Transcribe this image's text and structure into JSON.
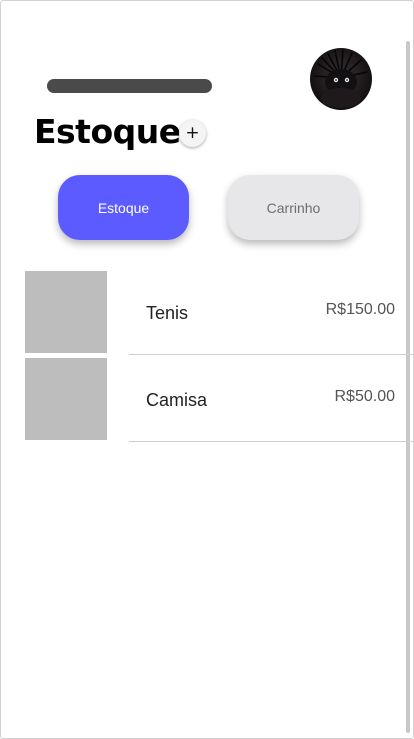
{
  "header": {
    "title": "Estoque",
    "add_label": "+",
    "avatar_icon": "user-avatar"
  },
  "tabs": [
    {
      "label": "Estoque",
      "active": true,
      "color": "#5b5bff"
    },
    {
      "label": "Carrinho",
      "active": false,
      "color": "#e7e7ea"
    }
  ],
  "products": [
    {
      "name": "Tenis",
      "price": "R$150.00"
    },
    {
      "name": "Camisa",
      "price": "R$50.00"
    }
  ]
}
